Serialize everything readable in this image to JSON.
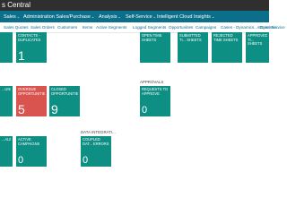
{
  "app": {
    "title": "s Central"
  },
  "menu": [
    {
      "label": "Sales",
      "caret": "⌄"
    },
    {
      "label": "Administration Sales/Purchase",
      "caret": "⌄"
    },
    {
      "label": "Analysis",
      "caret": "⌄"
    },
    {
      "label": "Self-Service",
      "caret": "⌄"
    },
    {
      "label": "Intelligent Cloud Insights",
      "caret": "⌄"
    }
  ],
  "subnav": [
    "Sales Quotes",
    "Sales Orders",
    "Customers",
    "Items",
    "Active Segments",
    "Logged Segments",
    "Opportunities",
    "Campaigns",
    "Cases - Dynamics...stomer Service",
    "Dynamic..."
  ],
  "tiles": {
    "t1": {
      "label": "",
      "value": ""
    },
    "contacts_duplicates": {
      "label": "CONTACTS - DUPLICATES",
      "value": "1"
    },
    "open_time_sheets": {
      "label": "OPEN TIME SHEETS",
      "value": ""
    },
    "submitted_time_sheets": {
      "label": "SUBMITTED TI... SHEETS",
      "value": ""
    },
    "rejected_time_sheets": {
      "label": "REJECTED TIME SHEETS",
      "value": ""
    },
    "approved_time_sheets": {
      "label": "APPROVED TI... SHEETS",
      "value": ""
    },
    "opportunities_left": {
      "label": "...UNITIE...",
      "value": ""
    },
    "overdue_opportunities": {
      "label": "OVERDUE OPPORTUNITIES",
      "value": "5"
    },
    "closed_opportunities": {
      "label": "CLOSED OPPORTUNITIES",
      "value": "9"
    },
    "requests_to_approve": {
      "label": "REQUESTS TO APPROVE",
      "value": "0"
    },
    "sales_left": {
      "label": "...ALES...",
      "value": ""
    },
    "active_campaigns": {
      "label": "ACTIVE CAMPAIGNS",
      "value": "0"
    },
    "coupled_data_errors": {
      "label": "COUPLED DAT... ERRORS",
      "value": "0"
    }
  },
  "sections": {
    "approvals": "APPROVALS",
    "data_integration": "DATA INTEGRATI..."
  }
}
